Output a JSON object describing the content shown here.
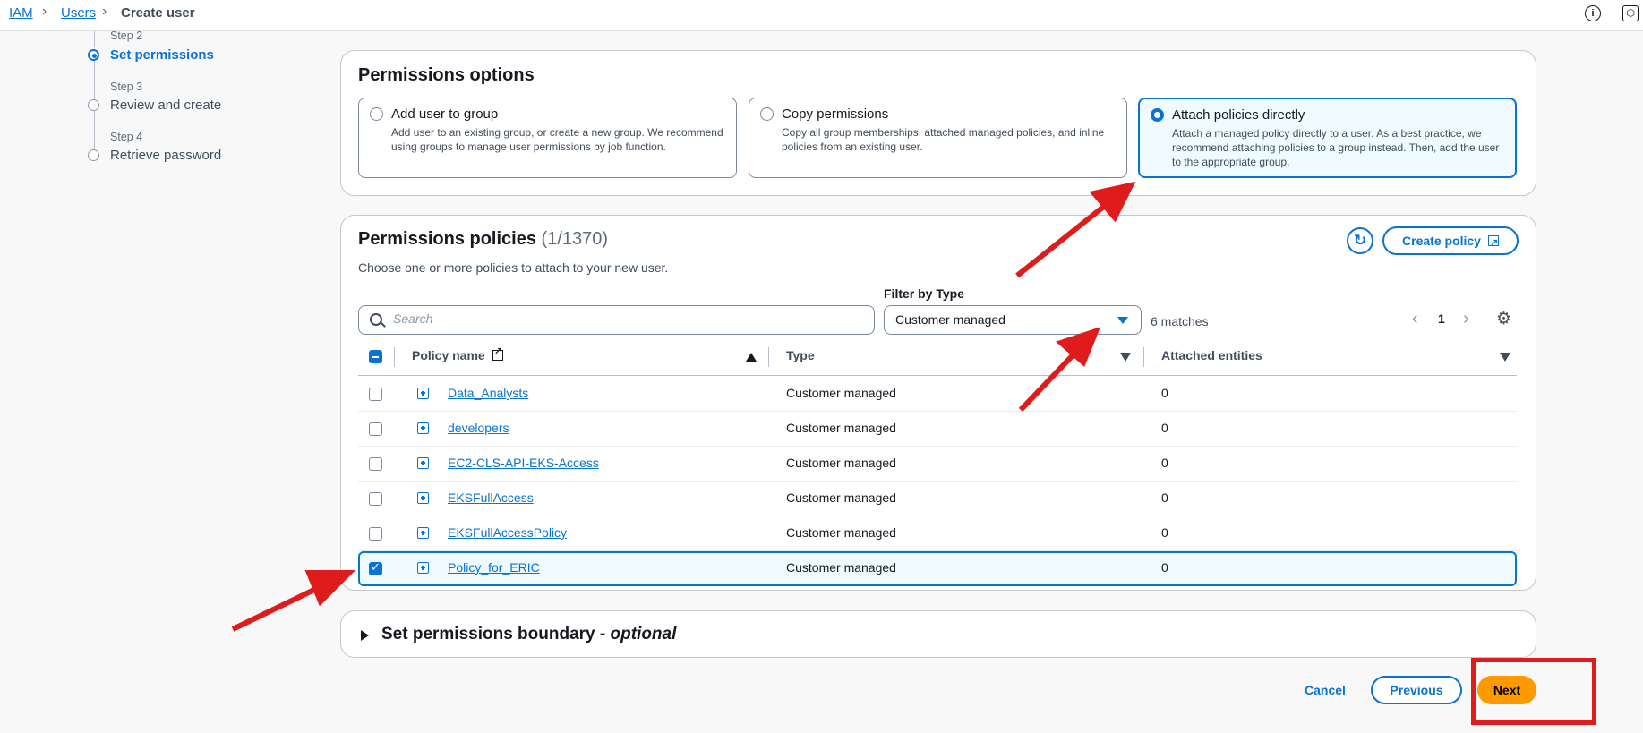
{
  "breadcrumb": {
    "iam": "IAM",
    "users": "Users",
    "current": "Create user"
  },
  "stepper": {
    "steps": [
      {
        "number": "Step 2",
        "label": "Set permissions",
        "active": true
      },
      {
        "number": "Step 3",
        "label": "Review and create",
        "active": false
      },
      {
        "number": "Step 4",
        "label": "Retrieve password",
        "active": false
      }
    ]
  },
  "permissions_options": {
    "title": "Permissions options",
    "tiles": [
      {
        "title": "Add user to group",
        "description": "Add user to an existing group, or create a new group. We recommend using groups to manage user permissions by job function.",
        "selected": false
      },
      {
        "title": "Copy permissions",
        "description": "Copy all group memberships, attached managed policies, and inline policies from an existing user.",
        "selected": false
      },
      {
        "title": "Attach policies directly",
        "description": "Attach a managed policy directly to a user. As a best practice, we recommend attaching policies to a group instead. Then, add the user to the appropriate group.",
        "selected": true
      }
    ]
  },
  "policies": {
    "title": "Permissions policies",
    "count": "(1/1370)",
    "description": "Choose one or more policies to attach to your new user.",
    "create_policy_label": "Create policy",
    "search_placeholder": "Search",
    "filter_label": "Filter by Type",
    "filter_value": "Customer managed",
    "matches": "6 matches",
    "page": "1",
    "columns": {
      "name": "Policy name",
      "type": "Type",
      "attached": "Attached entities"
    },
    "rows": [
      {
        "name": "Data_Analysts",
        "type": "Customer managed",
        "attached": "0",
        "checked": false
      },
      {
        "name": "developers",
        "type": "Customer managed",
        "attached": "0",
        "checked": false
      },
      {
        "name": "EC2-CLS-API-EKS-Access",
        "type": "Customer managed",
        "attached": "0",
        "checked": false
      },
      {
        "name": "EKSFullAccess",
        "type": "Customer managed",
        "attached": "0",
        "checked": false
      },
      {
        "name": "EKSFullAccessPolicy",
        "type": "Customer managed",
        "attached": "0",
        "checked": false
      },
      {
        "name": "Policy_for_ERIC",
        "type": "Customer managed",
        "attached": "0",
        "checked": true
      }
    ]
  },
  "boundary": {
    "title": "Set permissions boundary - ",
    "optional": "optional"
  },
  "footer": {
    "cancel": "Cancel",
    "previous": "Previous",
    "next": "Next"
  },
  "colors": {
    "accent": "#0972d3",
    "primary_button": "#ff9900",
    "annotation_red": "#e01b1b"
  }
}
